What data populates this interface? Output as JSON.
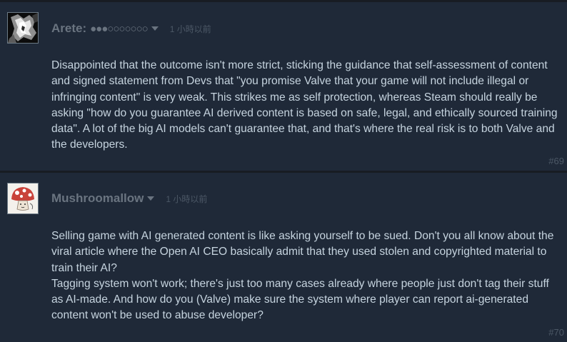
{
  "comments": [
    {
      "author": "Arete:",
      "status": "●●●○○○○○○○",
      "timestamp": "1 小時以前",
      "avatar_icon": "abstract-grey-avatar",
      "paragraphs": [
        "Disappointed that the outcome isn't more strict, sticking the guidance that self-assessment of content and signed statement from Devs that \"you promise Valve that your game will not include illegal or infringing content\" is very weak. This strikes me as self protection, whereas Steam should really be asking \"how do you guarantee AI derived content is based on safe, legal, and ethically sourced training data\". A lot of the big AI models can't guarantee that, and that's where the real risk is to both Valve and the developers."
      ],
      "index": "#69"
    },
    {
      "author": "Mushroomallow",
      "status": "",
      "timestamp": "1 小時以前",
      "avatar_icon": "mushroom-avatar",
      "paragraphs": [
        "Selling game with AI generated content is like asking yourself to be sued. Don't you all know about the viral article where the Open AI CEO basically admit that they used stolen and copyrighted material to train their AI?",
        "Tagging system won't work; there's just too many cases already where people just don't tag their stuff as AI-made. And how do you (Valve) make sure the system where player can report ai-generated content won't be used to abuse developer?"
      ],
      "index": "#70"
    }
  ],
  "colors": {
    "page_background": "#181c23",
    "comment_background": "#1f2938",
    "author_text": "#6a7480",
    "body_text": "#c6d4df",
    "muted_text": "#4c5866"
  }
}
